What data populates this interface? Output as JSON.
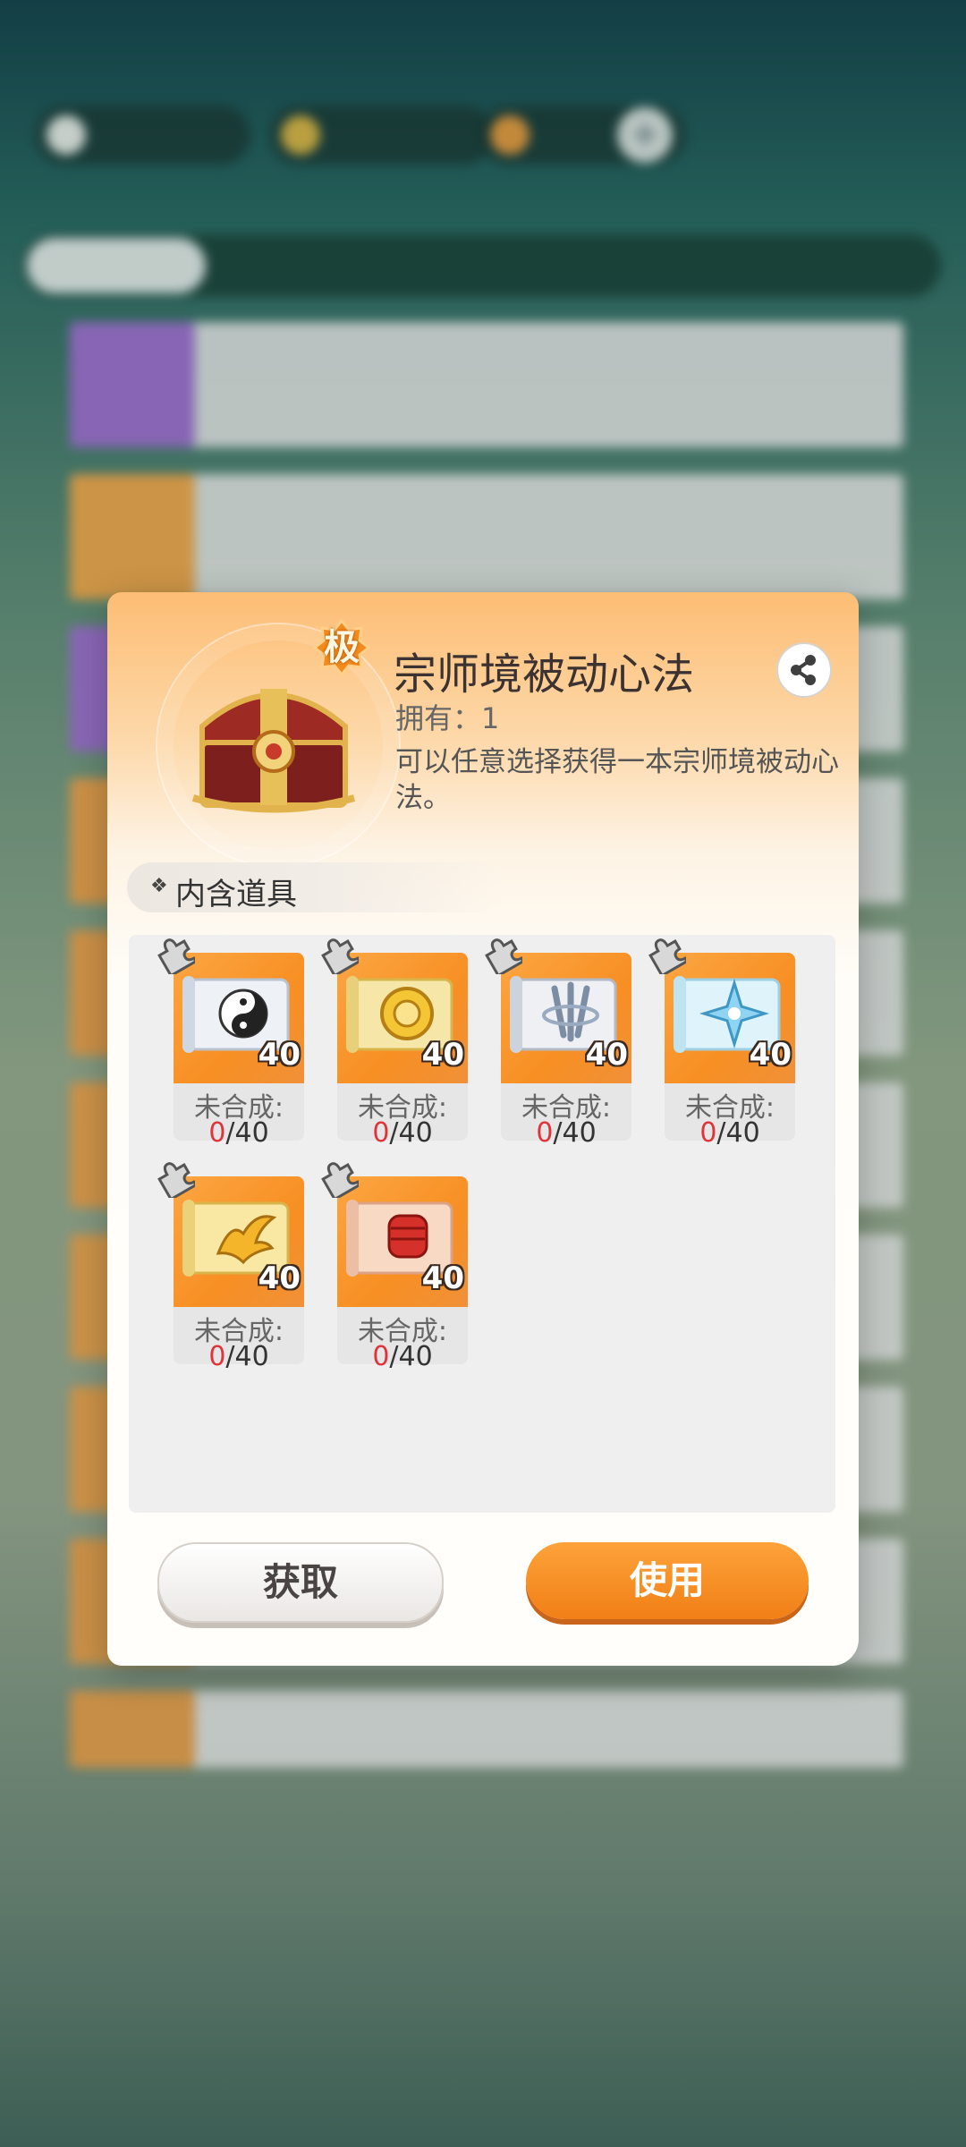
{
  "background": {
    "currencies": [
      {
        "icon": "gold-icon",
        "value": ""
      },
      {
        "icon": "crystal-icon",
        "value": ""
      }
    ],
    "tabs": [
      "",
      "",
      "",
      "",
      ""
    ],
    "list_rows": [
      {
        "name": "",
        "count": ""
      },
      {
        "name": "",
        "count": ""
      }
    ],
    "bottom_text": "",
    "nav_items": [
      "",
      "",
      "",
      "",
      "",
      ""
    ]
  },
  "modal": {
    "grade_badge": "极",
    "title": "宗师境被动心法",
    "owned": "拥有：1",
    "description": "可以任意选择获得一本宗师境被动心法。",
    "section_label": "内含道具",
    "items": [
      {
        "icon": "yin-yang-scroll-icon",
        "count": "40",
        "status": "未合成:",
        "have": "0",
        "need": "/40"
      },
      {
        "icon": "golden-emblem-scroll-icon",
        "count": "40",
        "status": "未合成:",
        "have": "0",
        "need": "/40"
      },
      {
        "icon": "silver-blades-scroll-icon",
        "count": "40",
        "status": "未合成:",
        "have": "0",
        "need": "/40"
      },
      {
        "icon": "ice-star-scroll-icon",
        "count": "40",
        "status": "未合成:",
        "have": "0",
        "need": "/40"
      },
      {
        "icon": "phoenix-scroll-icon",
        "count": "40",
        "status": "未合成:",
        "have": "0",
        "need": "/40"
      },
      {
        "icon": "red-fist-scroll-icon",
        "count": "40",
        "status": "未合成:",
        "have": "0",
        "need": "/40"
      }
    ],
    "buttons": {
      "get_label": "获取",
      "use_label": "使用"
    }
  }
}
